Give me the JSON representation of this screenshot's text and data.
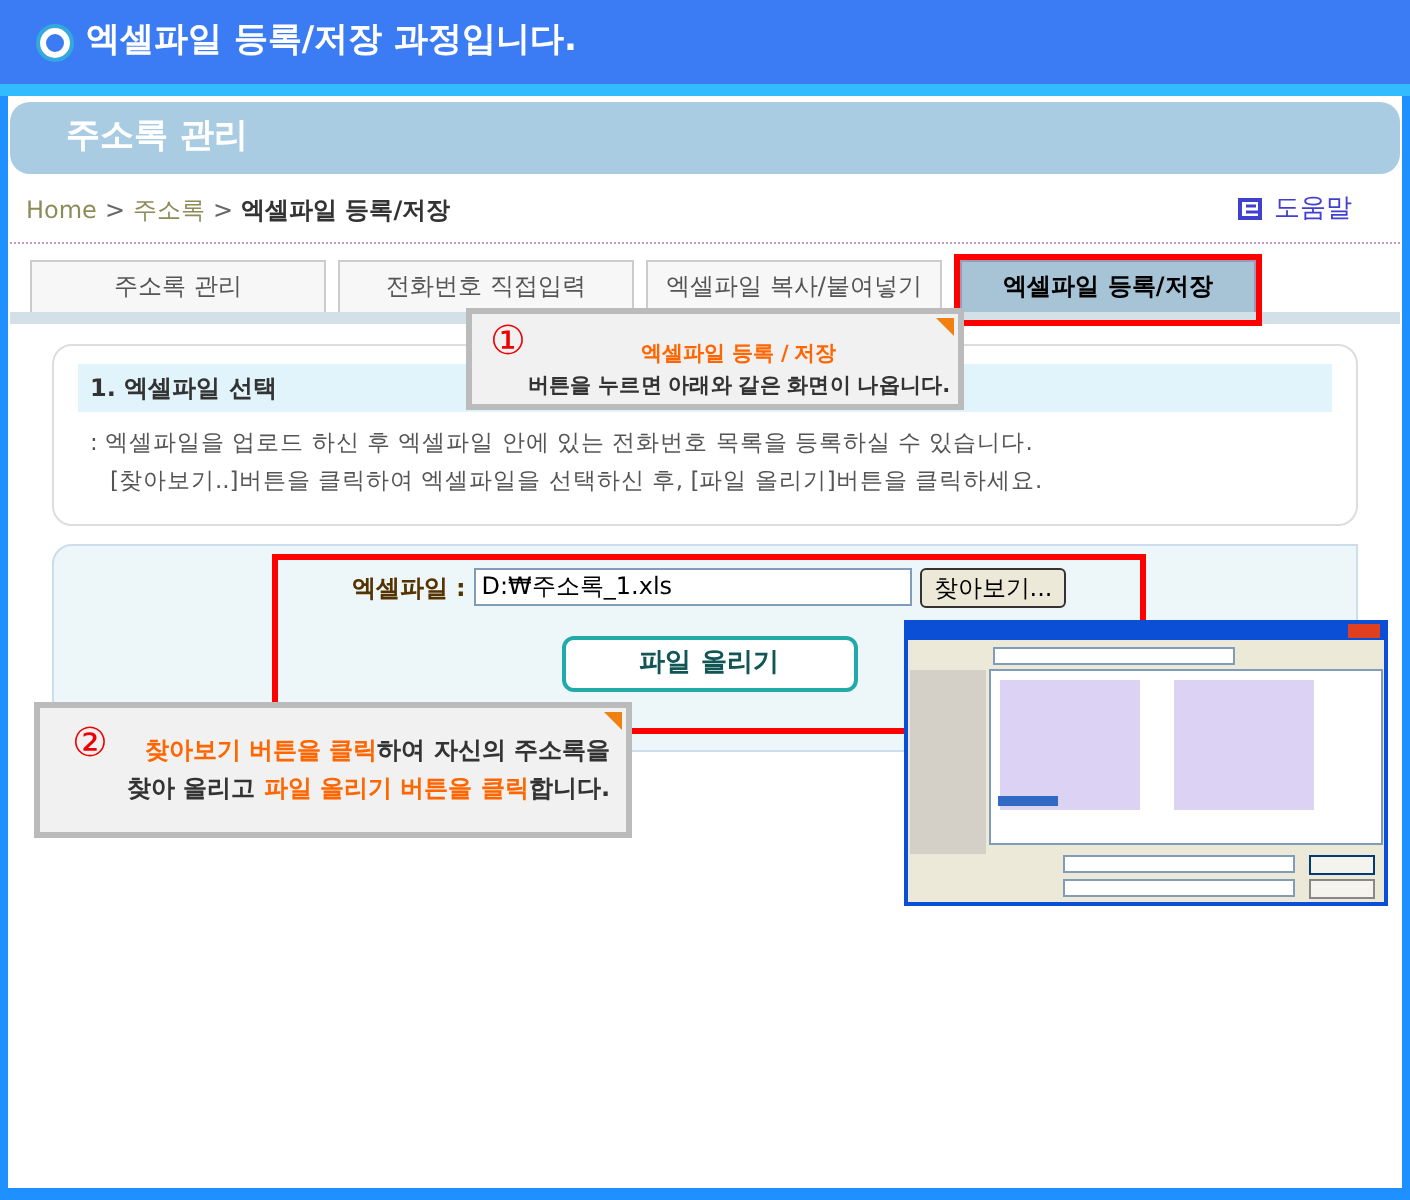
{
  "header": {
    "title": "엑셀파일 등록/저장 과정입니다."
  },
  "section_title": "주소록 관리",
  "breadcrumb": [
    {
      "kind": "link",
      "text": "Home"
    },
    {
      "kind": "separator",
      "text": ">"
    },
    {
      "kind": "link",
      "text": "주소록"
    },
    {
      "kind": "separator",
      "text": ">"
    },
    {
      "kind": "current",
      "text": "엑셀파일 등록/저장"
    }
  ],
  "help_link": "도움말",
  "tabs": [
    {
      "label": "주소록 관리",
      "selected": false
    },
    {
      "label": "전화번호 직접입력",
      "selected": false
    },
    {
      "label": "엑셀파일 복사/붙여넣기",
      "selected": false
    },
    {
      "label": "엑셀파일 등록/저장",
      "selected": true
    }
  ],
  "step1": {
    "title": "1. 엑셀파일 선택",
    "lines": [
      ": 엑셀파일을 업로드 하신 후 엑셀파일 안에 있는 전화번호 목록을 등록하실 수 있습니다.",
      "[찾아보기..]버튼을 클릭하여 엑셀파일을 선택하신 후, [파일 올리기]버튼을 클릭하세요."
    ]
  },
  "upload": {
    "label": "엑셀파일 :",
    "file_value": "D:₩주소록_1.xls",
    "browse_button": "찾아보기...",
    "upload_button": "파일 올리기"
  },
  "callouts": [
    {
      "number": "①",
      "lines": [
        "**엑셀파일 등록 / 저장**",
        "버튼을 누르면 아래와 같은 화면이 나옵니다."
      ]
    },
    {
      "number": "②",
      "lines": [
        "**찾아보기 버튼을 클릭**하여 자신의 주소록을",
        "찾아 올리고 **파일 올리기 버튼을 클릭**합니다."
      ]
    }
  ]
}
